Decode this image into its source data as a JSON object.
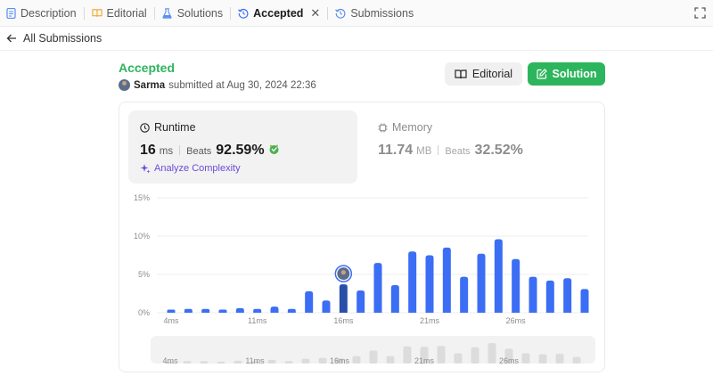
{
  "tabs": [
    {
      "label": "Description",
      "icon": "document-icon"
    },
    {
      "label": "Editorial",
      "icon": "book-icon"
    },
    {
      "label": "Solutions",
      "icon": "flask-icon"
    },
    {
      "label": "Accepted",
      "icon": "history-icon",
      "active": true
    },
    {
      "label": "Submissions",
      "icon": "history-icon"
    }
  ],
  "back": {
    "label": "All Submissions"
  },
  "submission": {
    "status": "Accepted",
    "user": "Sarma",
    "submitted_text": "submitted at Aug 30, 2024 22:36"
  },
  "buttons": {
    "editorial": "Editorial",
    "solution": "Solution"
  },
  "runtime": {
    "title": "Runtime",
    "value": "16",
    "unit": "ms",
    "beats_label": "Beats",
    "beats_pct": "92.59%",
    "analyze_label": "Analyze Complexity"
  },
  "memory": {
    "title": "Memory",
    "value": "11.74",
    "unit": "MB",
    "beats_label": "Beats",
    "beats_pct": "32.52%"
  },
  "colors": {
    "accent_green": "#2db55d",
    "bar_blue": "#3b6ef5",
    "analyze_purple": "#6b4bd8"
  },
  "chart_data": {
    "type": "bar",
    "ylabel": "",
    "xlabel": "",
    "ylim": [
      0,
      15
    ],
    "y_ticks": [
      "15%",
      "10%",
      "5%",
      "0%"
    ],
    "x_tick_labels": [
      "4ms",
      "11ms",
      "16ms",
      "21ms",
      "26ms"
    ],
    "values": [
      0.4,
      0.5,
      0.5,
      0.4,
      0.6,
      0.5,
      0.8,
      0.5,
      2.8,
      1.6,
      3.7,
      2.9,
      6.5,
      3.6,
      8.0,
      7.5,
      8.5,
      4.7,
      7.7,
      9.6,
      7.0,
      4.7,
      4.2,
      4.5,
      3.1
    ],
    "highlight_index": 10,
    "overview_tick_labels": [
      "4ms",
      "11ms",
      "16ms",
      "21ms",
      "26ms"
    ],
    "overview_values": [
      0.4,
      0.5,
      0.5,
      0.4,
      0.6,
      0.5,
      0.8,
      0.5,
      1.0,
      1.2,
      1.1,
      1.6,
      2.8,
      1.6,
      3.7,
      3.6,
      3.8,
      2.2,
      3.5,
      4.4,
      3.2,
      2.2,
      2.0,
      2.1,
      1.4
    ]
  }
}
